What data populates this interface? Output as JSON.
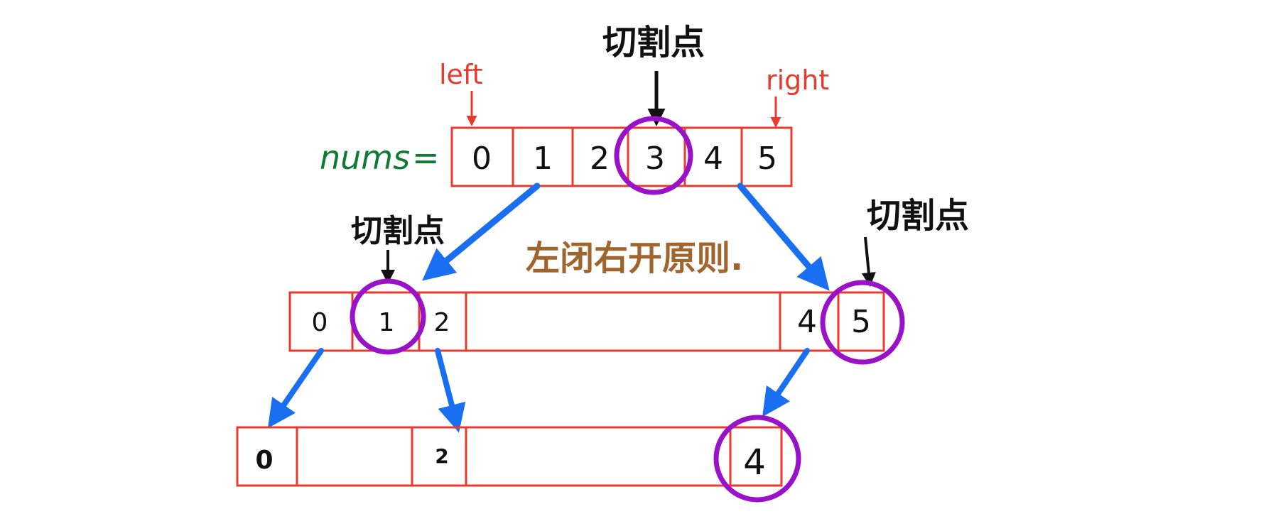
{
  "labels": {
    "array_name": "nums",
    "equals": "=",
    "left": "left",
    "right": "right",
    "split_point": "切割点",
    "rule": "左闭右开原则."
  },
  "array": [
    "0",
    "1",
    "2",
    "3",
    "4",
    "5"
  ],
  "row2": {
    "left_cells": [
      "0",
      "1",
      "2"
    ],
    "right_cells": [
      "4",
      "5"
    ]
  },
  "row3": {
    "cells": [
      "0",
      "2",
      "4"
    ]
  },
  "colors": {
    "box": "#e63b2e",
    "circle": "#9a12c8",
    "arrow_blue": "#1a6ff0",
    "pointer_red": "#e63b2e",
    "nums_green": "#0f7a34",
    "rule_brown": "#a0652d",
    "ink": "#111111"
  }
}
